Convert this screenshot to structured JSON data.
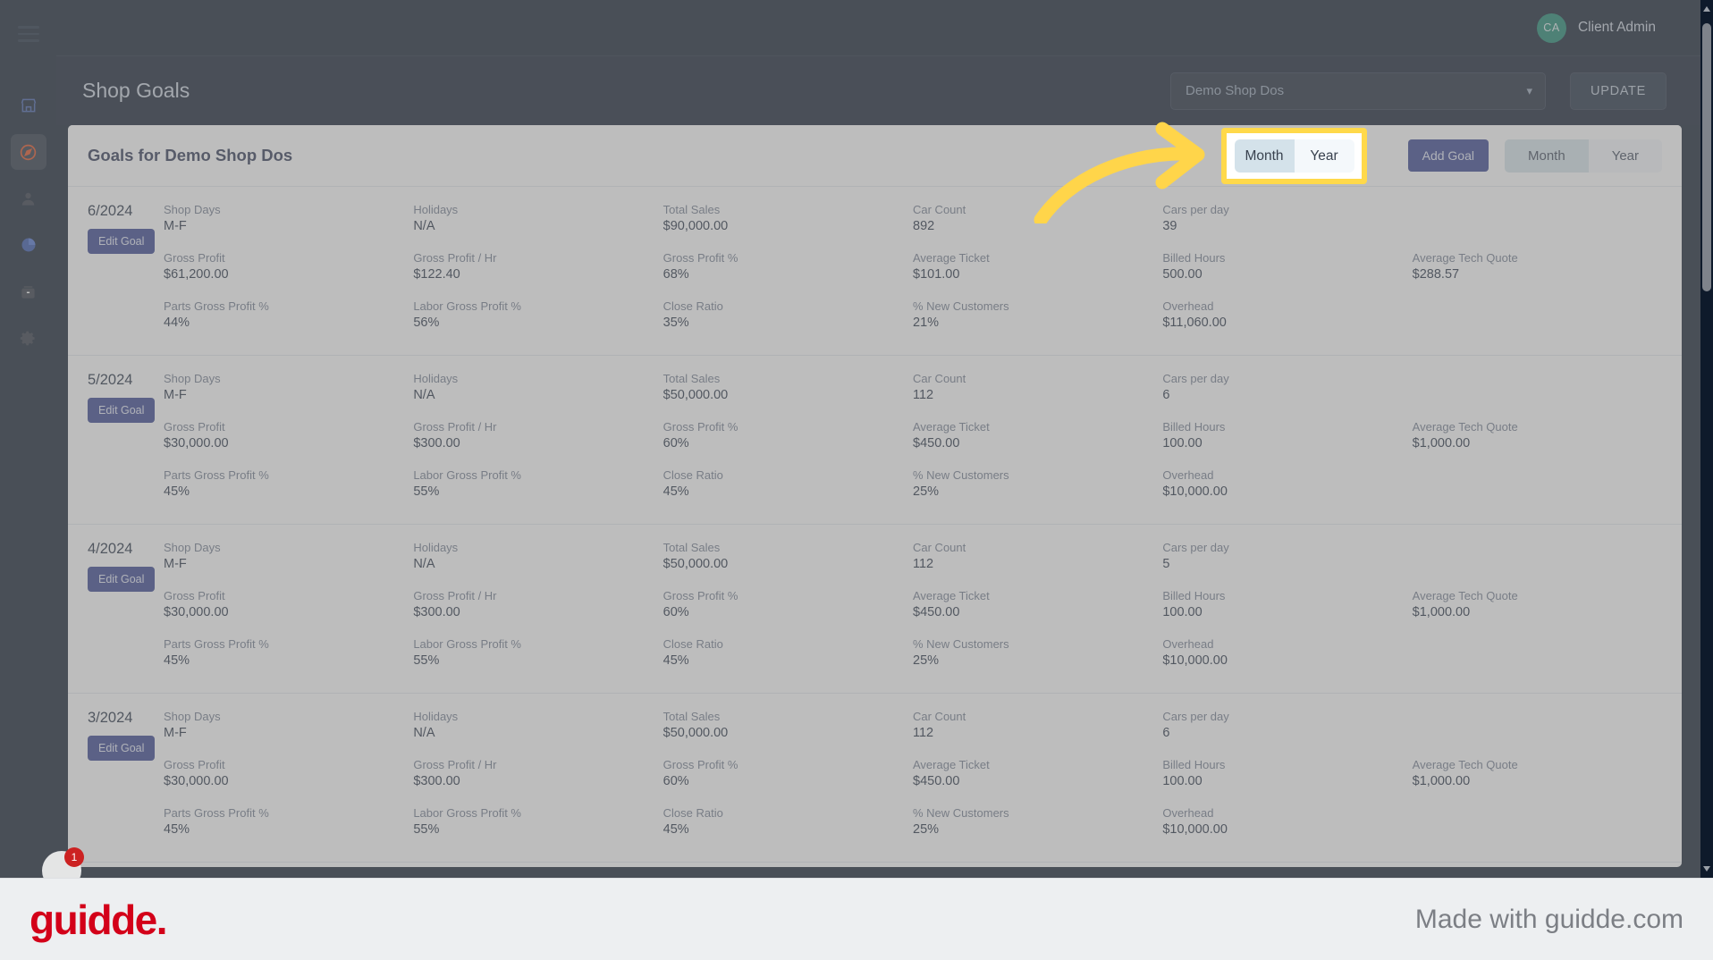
{
  "app": {
    "page_title": "Shop Goals",
    "user": {
      "initials": "CA",
      "name": "Client Admin"
    }
  },
  "sidebar": {
    "menu_icon": "hamburger-menu-icon",
    "items": [
      {
        "icon": "store-icon",
        "active": false
      },
      {
        "icon": "compass-icon",
        "active": true
      },
      {
        "icon": "person-icon",
        "active": false
      },
      {
        "icon": "pie-chart-icon",
        "active": false
      },
      {
        "icon": "archive-box-icon",
        "active": false
      },
      {
        "icon": "gear-icon",
        "active": false
      }
    ]
  },
  "header": {
    "shop_select_value": "Demo Shop Dos",
    "shop_select_options": [
      "Demo Shop Dos"
    ],
    "update_label": "UPDATE",
    "chevron_icon": "chevron-down-icon"
  },
  "card": {
    "title": "Goals for Demo Shop Dos",
    "add_goal_label": "Add Goal",
    "period_toggle": {
      "options": [
        "Month",
        "Year"
      ],
      "selected": "Month"
    },
    "edit_goal_label": "Edit Goal"
  },
  "annotation": {
    "arrow_color": "#ffd54a",
    "highlight_border_color": "#ffd94a",
    "highlight_target": "period-toggle"
  },
  "branding": {
    "logo_text": "guidde.",
    "logo_color": "#d30019",
    "made_with": "Made with guidde.com",
    "notification_count": "1"
  },
  "field_labels": [
    "Shop Days",
    "Holidays",
    "Total Sales",
    "Car Count",
    "Cars per day",
    "",
    "Gross Profit",
    "Gross Profit / Hr",
    "Gross Profit %",
    "Average Ticket",
    "Billed Hours",
    "Average Tech Quote",
    "Parts Gross Profit %",
    "Labor Gross Profit %",
    "Close Ratio",
    "% New Customers",
    "Overhead",
    ""
  ],
  "goals": [
    {
      "month": "6/2024",
      "values": [
        "M-F",
        "N/A",
        "$90,000.00",
        "892",
        "39",
        "",
        "$61,200.00",
        "$122.40",
        "68%",
        "$101.00",
        "500.00",
        "$288.57",
        "44%",
        "56%",
        "35%",
        "21%",
        "$11,060.00",
        ""
      ]
    },
    {
      "month": "5/2024",
      "values": [
        "M-F",
        "N/A",
        "$50,000.00",
        "112",
        "6",
        "",
        "$30,000.00",
        "$300.00",
        "60%",
        "$450.00",
        "100.00",
        "$1,000.00",
        "45%",
        "55%",
        "45%",
        "25%",
        "$10,000.00",
        ""
      ]
    },
    {
      "month": "4/2024",
      "values": [
        "M-F",
        "N/A",
        "$50,000.00",
        "112",
        "5",
        "",
        "$30,000.00",
        "$300.00",
        "60%",
        "$450.00",
        "100.00",
        "$1,000.00",
        "45%",
        "55%",
        "45%",
        "25%",
        "$10,000.00",
        ""
      ]
    },
    {
      "month": "3/2024",
      "values": [
        "M-F",
        "N/A",
        "$50,000.00",
        "112",
        "6",
        "",
        "$30,000.00",
        "$300.00",
        "60%",
        "$450.00",
        "100.00",
        "$1,000.00",
        "45%",
        "55%",
        "45%",
        "25%",
        "$10,000.00",
        ""
      ]
    }
  ]
}
